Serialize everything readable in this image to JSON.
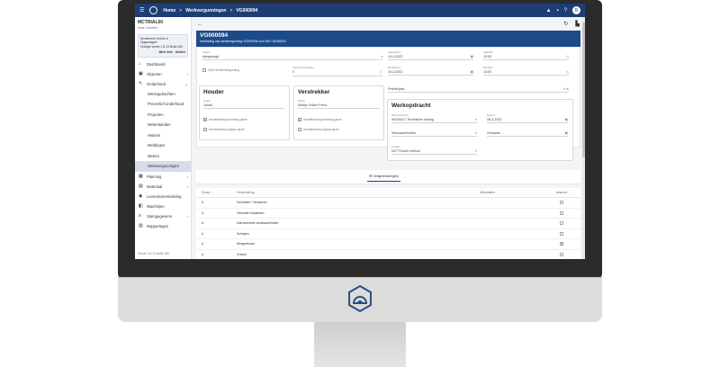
{
  "topbar": {
    "crumbs": [
      "Home",
      "Werkvergunningen",
      "VG000094"
    ],
    "separator": ">",
    "avatar": "B"
  },
  "sidebar": {
    "user_name": "MCTRIAL60",
    "user_role": "Jens Corbello",
    "status_text": "Momenteel Online & Opgeslagen!",
    "status_sub": "Huidige versie 1.8.13 Build 160",
    "status_btn_more": "Meer Info",
    "status_btn_close": "Sluiten",
    "items": [
      {
        "label": "Dashboard",
        "icon": "⌂"
      },
      {
        "label": "Objecten",
        "icon": "▣",
        "chev": "›"
      },
      {
        "label": "Onderhoud",
        "icon": "✎",
        "chev": "⌄"
      }
    ],
    "sub_items": [
      "Werkopdrachten",
      "Preventief onderhoud",
      "Projecten",
      "Meterstanden",
      "Historie",
      "Meldingen",
      "Meters",
      "Werkvergunningen"
    ],
    "items2": [
      {
        "label": "Planning",
        "icon": "▦",
        "chev": "›"
      },
      {
        "label": "Materiaal",
        "icon": "▤",
        "chev": "›"
      },
      {
        "label": "Leveranciersindeling",
        "icon": "◉"
      },
      {
        "label": "Wachtrijen",
        "icon": "◧"
      },
      {
        "label": "Stamgegevens",
        "icon": "≡",
        "chev": "›"
      },
      {
        "label": "Rapportages",
        "icon": "▥"
      }
    ],
    "version": "Versie 1.8.13 Build 160"
  },
  "content": {
    "back": "←",
    "title": "VG000094",
    "subtitle": "Verbinding van werkvergunning VG000094 voor WO: WO00021",
    "fields": {
      "status_label": "Status",
      "status_value": "Aangezegd",
      "checkbox_label": "Open werkenvergunning",
      "start_date_label": "Startdatum",
      "start_date_value": "19-4-2023",
      "start_time_label": "Starttijd",
      "start_time_value": "10:00",
      "end_date_label": "Einddatum",
      "end_date_value": "19-4-2023",
      "end_time_label": "Eindtijd",
      "end_time_value": "14:00",
      "amount_label": "Aantal werkdagen",
      "amount_value": "0",
      "positie_label": "Positie/plek"
    },
    "houder": {
      "title": "Houder",
      "name_label": "Naam",
      "name_value": "Johan",
      "check1": "Handtekening aanvraag gezet",
      "check2": "Handtekening uitgave gezet"
    },
    "verstrekker": {
      "title": "Verstrekker",
      "name_label": "Naam",
      "name_value": "Martijn Online Perco",
      "check1": "Handtekening aanvraag gezet",
      "check2": "Handtekening uitgave gezet"
    },
    "werkopdracht": {
      "title": "Werkopdracht",
      "wo_label": "Werkopdracht",
      "wo_value": "WO00021 Technische storing",
      "date_label": "Datum",
      "date_value": "28-3-2023",
      "field2_label": "Werkzaamheden",
      "field3_label": "Geraakte ...",
      "field4_label": "Locatie",
      "field4_value": "NCT Ruurlo Verhuur"
    },
    "tab_label": "Veiligheidsregels",
    "table": {
      "headers": [
        "Groep",
        "Omschrijving",
        "Uitkomsten",
        "Akkoord"
      ],
      "rows": [
        {
          "group": "A",
          "desc": "Voordelen / Verwarren",
          "checked": false
        },
        {
          "group": "A",
          "desc": "Gewelde holplekken",
          "checked": false
        },
        {
          "group": "A",
          "desc": "Instrumentele werkzaamheden",
          "checked": false
        },
        {
          "group": "A",
          "desc": "Schrijven",
          "checked": false
        },
        {
          "group": "A",
          "desc": "Stergerbouw*",
          "checked": true
        },
        {
          "group": "A",
          "desc": "Graven",
          "checked": false
        }
      ]
    }
  }
}
